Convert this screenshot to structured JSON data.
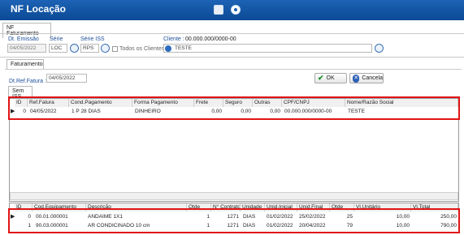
{
  "window": {
    "title": "NF Locação"
  },
  "tabs": {
    "main": "NF Faturamento",
    "sub": "Faturamento",
    "iss": "Sem ISS"
  },
  "fields": {
    "dt_emissao_label": "Dt. Emissão",
    "dt_emissao_value": "04/05/2022",
    "serie_label": "Série",
    "serie_value": "LOC",
    "serie_iss_label": "Série ISS",
    "serie_iss_value": "RPS",
    "todos_clientes_label": "Todos os Clientes",
    "cliente_label": "Cliente :",
    "cliente_cnpj": "00.000.000/0000-00",
    "cliente_value": "TESTE",
    "dt_ref_label": "Dt.Ref.Fatura :",
    "dt_ref_value": "04/05/2022"
  },
  "buttons": {
    "ok": "OK",
    "cancel": "Cancela"
  },
  "grid1": {
    "headers": [
      "ID",
      "Ref.Fatura",
      "Cond.Pagamento",
      "Forma Pagamento",
      "Frete",
      "Seguro",
      "Outras",
      "CPF/CNPJ",
      "Nome/Razão Social"
    ],
    "rows": [
      [
        "0",
        "04/05/2022",
        "1 P 28 DIAS",
        "DINHEIRO",
        "0,00",
        "0,00",
        "0,00",
        "00.000.000/0000-00",
        "TESTE"
      ]
    ]
  },
  "grid2": {
    "headers": [
      "ID",
      "Cod.Equipamento",
      "Descrição",
      "Qtde",
      "N° Contrato",
      "Unidade",
      "Unid.Inicial",
      "Unid.Final",
      "Qtde",
      "Vl.Unitário",
      "Vl.Total"
    ],
    "rows": [
      [
        "0",
        "00.01.000001",
        "ANDAIME 1X1",
        "1",
        "1271",
        "DIAS",
        "01/02/2022",
        "25/02/2022",
        "25",
        "10,00",
        "250,00"
      ],
      [
        "1",
        "90.03.000001",
        "AR CONDICINADO 10 cm",
        "1",
        "1271",
        "DIAS",
        "01/02/2022",
        "20/04/2022",
        "79",
        "10,00",
        "790,00"
      ]
    ]
  }
}
